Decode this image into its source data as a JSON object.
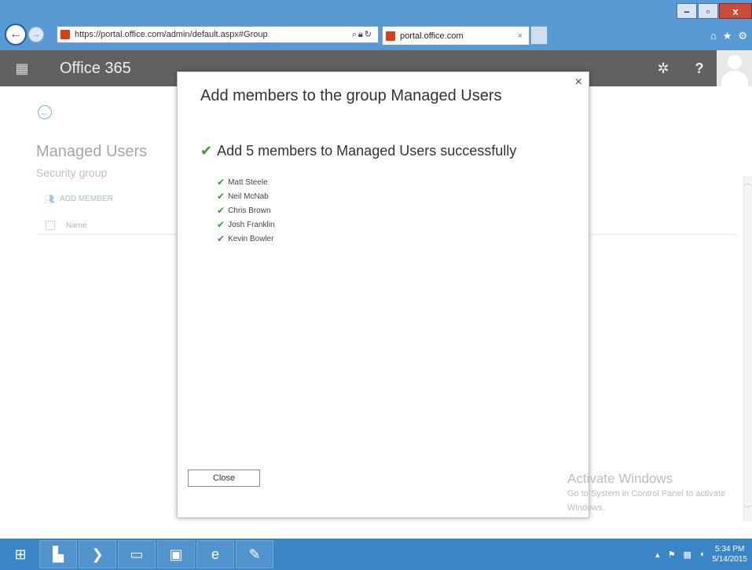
{
  "browser": {
    "url": "https://portal.office.com/admin/default.aspx#Group",
    "tab_title": "portal.office.com",
    "tab_close": "×",
    "window_buttons": {
      "minimize": "–",
      "restore": "▫",
      "close": "x"
    }
  },
  "header": {
    "app_title": "Office 365",
    "help_label": "?"
  },
  "page": {
    "group_title": "Managed Users",
    "group_type": "Security group",
    "add_member_label": "ADD MEMBER",
    "column_name": "Name"
  },
  "dialog": {
    "title": "Add members to the group Managed Users",
    "close_symbol": "×",
    "success_message": "Add 5 members to Managed Users successfully",
    "members": [
      {
        "name": "Matt Steele"
      },
      {
        "name": "Neil McNab"
      },
      {
        "name": "Chris Brown"
      },
      {
        "name": "Josh Franklin"
      },
      {
        "name": "Kevin Bowler"
      }
    ],
    "close_button": "Close"
  },
  "watermark": {
    "title": "Activate Windows",
    "subtitle": "Go to System in Control Panel to activate Windows."
  },
  "taskbar": {
    "time": "5:34 PM",
    "date": "5/14/2015"
  },
  "icons": {
    "check": "✔",
    "back": "←",
    "forward": "→",
    "waffle": "▦",
    "gear": "✲"
  },
  "colors": {
    "browser_chrome": "#5a9ad4",
    "o365_header": "#2d2d2d",
    "success_check": "#3b9b3b",
    "taskbar": "#3a85c6"
  }
}
